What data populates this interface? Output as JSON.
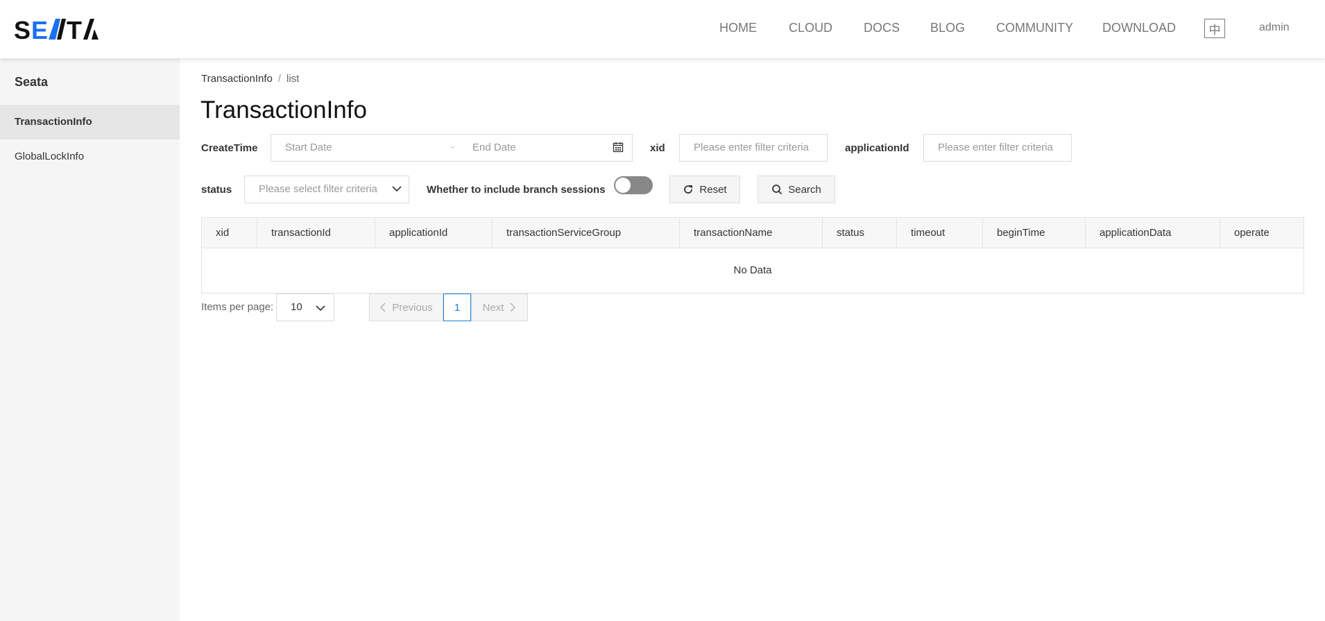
{
  "header": {
    "logo_text": "SEATA",
    "nav": [
      "HOME",
      "CLOUD",
      "DOCS",
      "BLOG",
      "COMMUNITY",
      "DOWNLOAD"
    ],
    "lang_label": "中",
    "user": "admin"
  },
  "sidebar": {
    "title": "Seata",
    "items": [
      {
        "label": "TransactionInfo",
        "active": true
      },
      {
        "label": "GlobalLockInfo",
        "active": false
      }
    ]
  },
  "breadcrumb": {
    "root": "TransactionInfo",
    "separator": "/",
    "current": "list"
  },
  "page_title": "TransactionInfo",
  "filters": {
    "create_time_label": "CreateTime",
    "start_placeholder": "Start Date",
    "date_separator": "-",
    "end_placeholder": "End Date",
    "xid_label": "xid",
    "xid_placeholder": "Please enter filter criteria",
    "application_label": "applicationId",
    "application_placeholder": "Please enter filter criteria",
    "status_label": "status",
    "status_placeholder": "Please select filter criteria",
    "branch_label": "Whether to include branch sessions",
    "branch_toggle_on": false,
    "reset_label": "Reset",
    "search_label": "Search"
  },
  "table": {
    "columns": [
      "xid",
      "transactionId",
      "applicationId",
      "transactionServiceGroup",
      "transactionName",
      "status",
      "timeout",
      "beginTime",
      "applicationData",
      "operate"
    ],
    "empty_text": "No Data"
  },
  "pagination": {
    "items_per_page_label": "Items per page:",
    "items_per_page_value": "10",
    "previous_label": "Previous",
    "current_page": "1",
    "next_label": "Next"
  },
  "colors": {
    "accent": "#1a7fd0",
    "logo_blue": "#1b6ff5",
    "sidebar_bg": "#f5f5f5"
  }
}
